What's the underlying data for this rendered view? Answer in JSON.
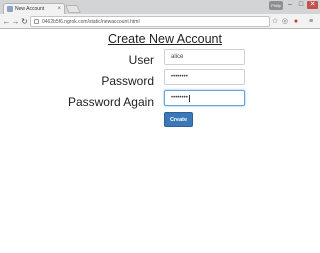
{
  "browser": {
    "tab_title": "New Account",
    "tab_close": "×",
    "user_badge": "Philip",
    "url": "0462b5f6.ngrok.com/static/newaccount.html",
    "minimize": "–",
    "maximize": "□",
    "close": "✕"
  },
  "icons": {
    "back": "←",
    "forward": "→",
    "reload": "↻",
    "star": "☆",
    "extension": "◎",
    "extension2": "●",
    "menu": "≡"
  },
  "form": {
    "title": "Create New Account",
    "user_label": "User",
    "user_value": "alice",
    "password_label": "Password",
    "password_value": "••••••••",
    "password_again_label": "Password Again",
    "password_again_value": "••••••••",
    "create_label": "Create"
  },
  "colors": {
    "button": "#3a78b8",
    "focus_border": "#66a3d9",
    "close_button": "#c7504a"
  }
}
